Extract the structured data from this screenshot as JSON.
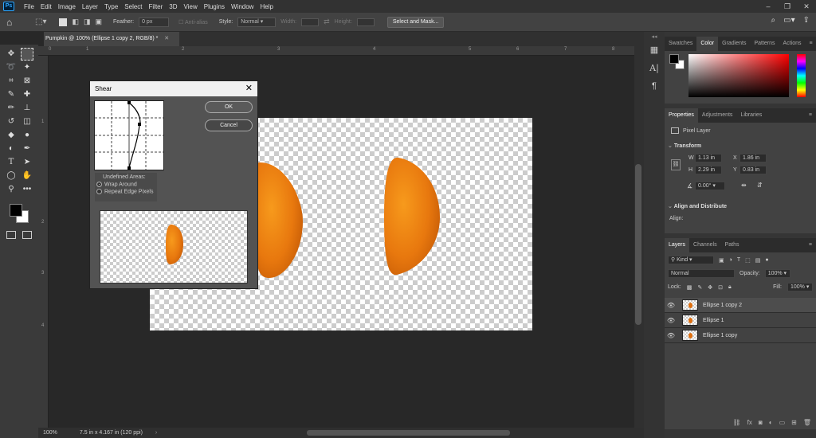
{
  "menu": {
    "app_icon": "Ps",
    "items": [
      "File",
      "Edit",
      "Image",
      "Layer",
      "Type",
      "Select",
      "Filter",
      "3D",
      "View",
      "Plugins",
      "Window",
      "Help"
    ],
    "window_controls": [
      "–",
      "❐",
      "✕"
    ]
  },
  "options_bar": {
    "feather_label": "Feather:",
    "feather_value": "0 px",
    "antialias_label": "Anti-alias",
    "style_label": "Style:",
    "style_value": "Normal",
    "width_label": "Width:",
    "height_label": "Height:",
    "select_mask_label": "Select and Mask..."
  },
  "document": {
    "tab_title": "Pumpkin @ 100% (Ellipse 1 copy 2, RGB/8) *",
    "ruler_top_ticks": [
      "0",
      "1",
      "2",
      "3",
      "4",
      "5",
      "6",
      "7",
      "8"
    ],
    "ruler_left_ticks": [
      "1",
      "2",
      "3",
      "4"
    ],
    "zoom": "100%",
    "doc_info": "7.5 in x 4.167 in (120 ppi)"
  },
  "shear_dialog": {
    "title": "Shear",
    "ok_label": "OK",
    "cancel_label": "Cancel",
    "undefined_areas_label": "Undefined Areas:",
    "options": [
      {
        "label": "Wrap Around",
        "selected": true
      },
      {
        "label": "Repeat Edge Pixels",
        "selected": false
      }
    ]
  },
  "color_panel": {
    "tabs": [
      "Swatches",
      "Color",
      "Gradients",
      "Patterns",
      "Actions"
    ],
    "active_tab": "Color",
    "hue_color": "#ff0000"
  },
  "properties_panel": {
    "tabs": [
      "Properties",
      "Adjustments",
      "Libraries"
    ],
    "active_tab": "Properties",
    "layer_type": "Pixel Layer",
    "transform_label": "Transform",
    "w_label": "W",
    "w_value": "1.13 in",
    "x_label": "X",
    "x_value": "1.86 in",
    "h_label": "H",
    "h_value": "2.29 in",
    "y_label": "Y",
    "y_value": "0.83 in",
    "angle_value": "0.00°",
    "align_label": "Align and Distribute",
    "align_sub": "Align:"
  },
  "layers_panel": {
    "tabs": [
      "Layers",
      "Channels",
      "Paths"
    ],
    "active_tab": "Layers",
    "filter_kind": "Kind",
    "blend_mode": "Normal",
    "opacity_label": "Opacity:",
    "opacity_value": "100%",
    "lock_label": "Lock:",
    "fill_label": "Fill:",
    "fill_value": "100%",
    "layers": [
      {
        "name": "Ellipse 1 copy 2",
        "selected": true
      },
      {
        "name": "Ellipse 1",
        "selected": false
      },
      {
        "name": "Ellipse 1 copy",
        "selected": false
      }
    ]
  },
  "colors": {
    "accent_orange": "#e8780e",
    "app_bg": "#282828"
  }
}
